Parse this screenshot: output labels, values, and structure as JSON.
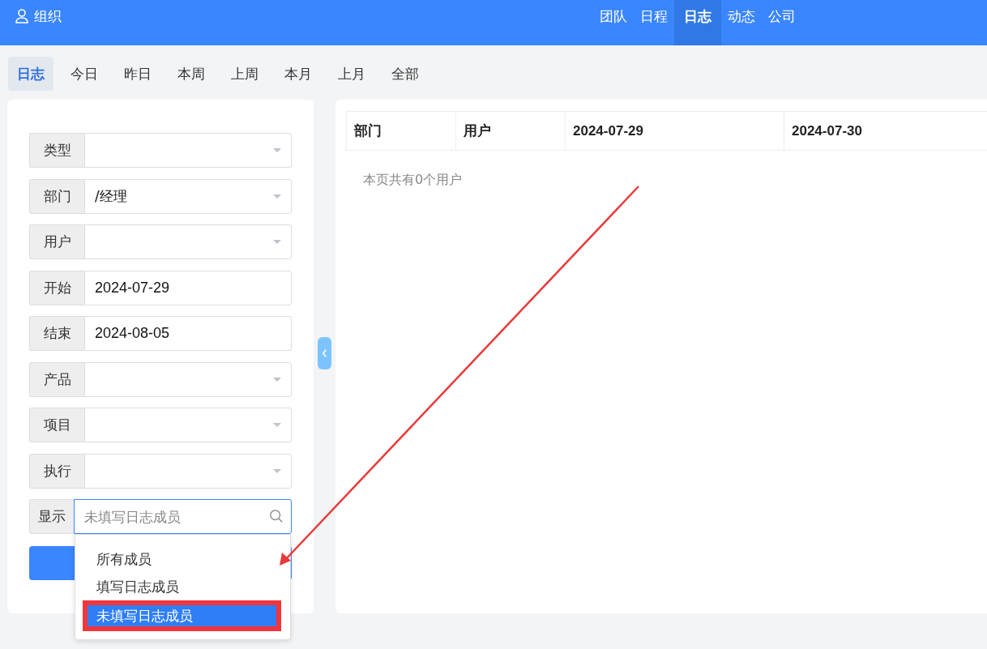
{
  "header": {
    "brand": "组织",
    "nav": [
      {
        "label": "团队",
        "selected": false
      },
      {
        "label": "日程",
        "selected": false
      },
      {
        "label": "日志",
        "selected": true
      },
      {
        "label": "动态",
        "selected": false
      },
      {
        "label": "公司",
        "selected": false
      }
    ]
  },
  "tabs": [
    {
      "label": "日志",
      "selected": true
    },
    {
      "label": "今日",
      "selected": false
    },
    {
      "label": "昨日",
      "selected": false
    },
    {
      "label": "本周",
      "selected": false
    },
    {
      "label": "上周",
      "selected": false
    },
    {
      "label": "本月",
      "selected": false
    },
    {
      "label": "上月",
      "selected": false
    },
    {
      "label": "全部",
      "selected": false
    }
  ],
  "filters": [
    {
      "label": "类型",
      "kind": "select"
    },
    {
      "label": "部门",
      "kind": "select",
      "value": "/经理"
    },
    {
      "label": "用户",
      "kind": "select"
    },
    {
      "label": "开始",
      "kind": "text",
      "value": "2024-07-29"
    },
    {
      "label": "结束",
      "kind": "text",
      "value": "2024-08-05"
    },
    {
      "label": "产品",
      "kind": "select"
    },
    {
      "label": "项目",
      "kind": "select"
    },
    {
      "label": "执行",
      "kind": "select"
    },
    {
      "label": "显示",
      "kind": "search",
      "placeholder": "未填写日志成员",
      "expanded": true,
      "options": [
        {
          "label": "所有成员",
          "selected": false
        },
        {
          "label": "填写日志成员",
          "selected": false
        },
        {
          "label": "未填写日志成员",
          "selected": true
        }
      ]
    }
  ],
  "table": {
    "columns": [
      "部门",
      "用户",
      "2024-07-29",
      "2024-07-30"
    ],
    "empty_message": "本页共有0个用户"
  }
}
